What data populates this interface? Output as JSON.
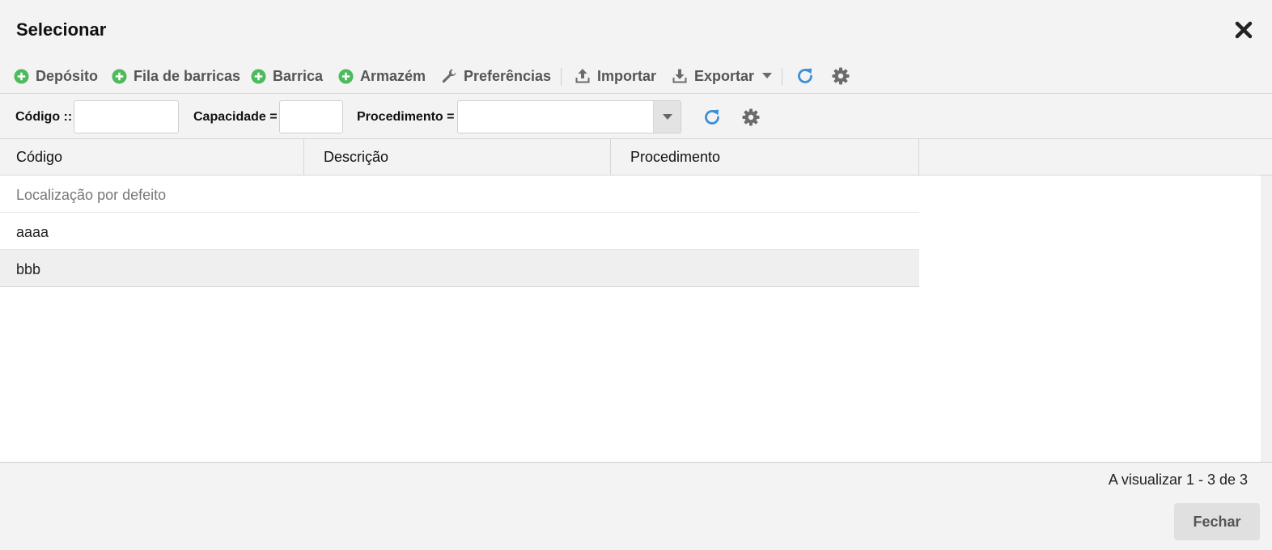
{
  "dialog": {
    "title": "Selecionar"
  },
  "toolbar": {
    "items": [
      {
        "label": "Depósito",
        "icon": "plus-circle-icon"
      },
      {
        "label": "Fila de barricas",
        "icon": "plus-circle-icon"
      },
      {
        "label": "Barrica",
        "icon": "plus-circle-icon"
      },
      {
        "label": "Armazém",
        "icon": "plus-circle-icon"
      },
      {
        "label": "Preferências",
        "icon": "wrench-icon"
      },
      {
        "label": "Importar",
        "icon": "upload-icon"
      },
      {
        "label": "Exportar",
        "icon": "download-icon"
      }
    ],
    "refresh_icon": "refresh-icon",
    "settings_icon": "gear-icon"
  },
  "filters": {
    "code_label": "Código ::",
    "code_value": "",
    "capacity_label": "Capacidade =",
    "capacity_value": "",
    "procedure_label": "Procedimento =",
    "procedure_value": ""
  },
  "grid": {
    "columns": [
      "Código",
      "Descrição",
      "Procedimento"
    ],
    "rows": [
      {
        "code": "Localização por defeito"
      },
      {
        "code": "aaaa"
      },
      {
        "code": "bbb"
      }
    ]
  },
  "footer": {
    "pager_text": "A visualizar 1 - 3 de 3",
    "close_label": "Fechar"
  },
  "colors": {
    "plus_icon": "#4cbb5b",
    "refresh_icon": "#3d8fd6",
    "muted_icon": "#6b6b6b"
  }
}
